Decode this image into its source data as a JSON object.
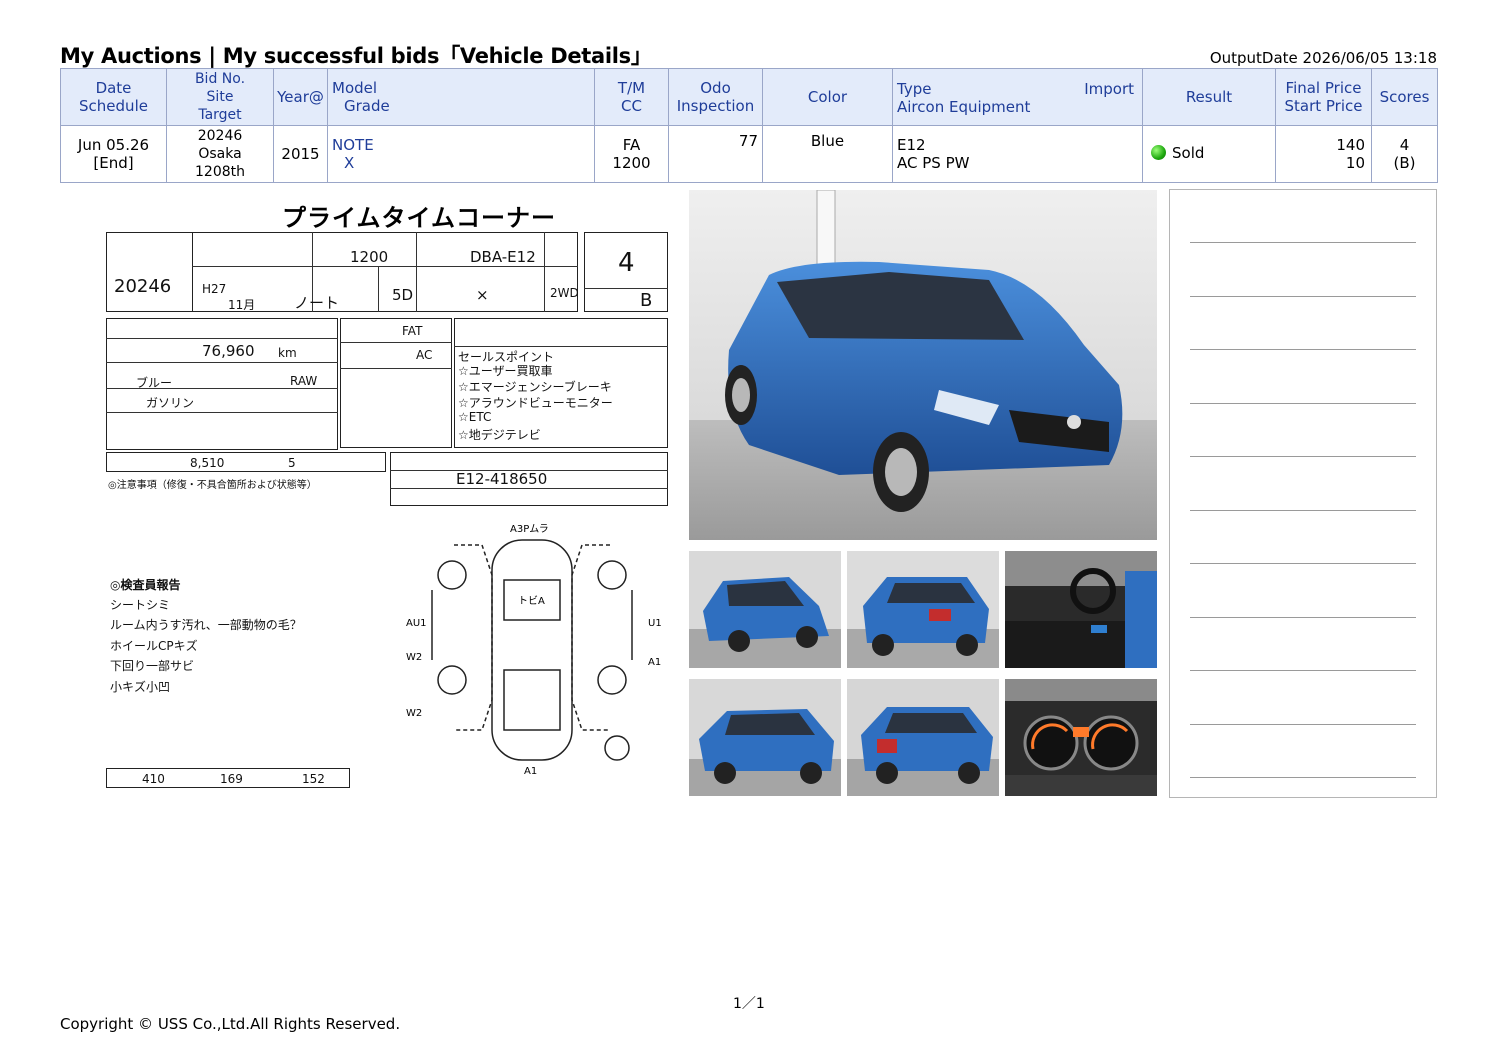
{
  "header": {
    "title": "My Auctions | My successful bids「Vehicle Details」",
    "output_date": "OutputDate  2026/06/05 13:18"
  },
  "table": {
    "headers": {
      "date": [
        "Date",
        "Schedule"
      ],
      "bid": [
        "Bid No.",
        "Site",
        "Target"
      ],
      "year": "Year@",
      "model": [
        "Model",
        "Grade"
      ],
      "tm": [
        "T/M",
        "CC"
      ],
      "odo": [
        "Odo",
        "Inspection"
      ],
      "color": "Color",
      "type": [
        "Type",
        "Aircon Equipment"
      ],
      "import": "Import",
      "result": "Result",
      "price": [
        "Final Price",
        "Start Price"
      ],
      "scores": "Scores"
    },
    "row": {
      "date": "Jun 05.26",
      "schedule": "[End]",
      "bid_no": "20246",
      "site": "Osaka",
      "target": "1208th",
      "year": "2015",
      "model": "NOTE",
      "grade": "X",
      "tm": "FA",
      "cc": "1200",
      "odo": "77",
      "color": "Blue",
      "type": "E12",
      "equipment": "AC PS PW",
      "result": "Sold",
      "final_price": "140",
      "start_price": "10",
      "score": "4",
      "score_sub": "(B)"
    }
  },
  "sheet": {
    "title": "プライムタイムコーナー",
    "lot_no": "20246",
    "reg_year": "H27",
    "reg_month": "11",
    "reg_month_unit": "月",
    "model_name": "ノート",
    "displacement": "1200",
    "model_code": "DBA-E12",
    "doors": "5D",
    "grade": "×",
    "drive": "2WD",
    "score": "4",
    "interior": "B",
    "shift": "FAT",
    "aircon": "AC",
    "mileage": "76,960",
    "mileage_unit": "km",
    "color": "ブルー",
    "color_code": "RAW",
    "fuel": "ガソリン",
    "recycle_fee": "8,510",
    "capacity": "5",
    "chassis": "E12-418650",
    "points_label": "セールスポイント",
    "points": [
      "☆ユーザー買取車",
      "☆エマージェンシーブレーキ",
      "☆アラウンドビューモニター",
      "☆ETC",
      "☆地デジテレビ"
    ],
    "report_label": "◎検査員報告",
    "report": [
      "シートシミ",
      "ルーム内うす汚れ、一部動物の毛？",
      "ホイールCPキズ",
      "下回り一部サビ",
      "小キズ小凹"
    ],
    "notes_label": "◎注意事項（修復・不具合箇所および状態等）",
    "dims": {
      "length": "410",
      "width": "169",
      "height": "152"
    },
    "diagram_labels": {
      "top": "A3Pムラ",
      "door": "トビA",
      "left1": "AU1",
      "left2": "W2",
      "left3": "W2",
      "right1": "U1",
      "right2": "A1",
      "bottom": "A1"
    }
  },
  "photos": [
    "main-front-3q",
    "thumb-front-left",
    "thumb-rear-left",
    "thumb-interior",
    "thumb-front-left-2",
    "thumb-rear-right",
    "thumb-gauges"
  ],
  "footer": {
    "page": "1／1",
    "copyright": "Copyright © USS Co.,Ltd.All Rights Reserved."
  },
  "colors": {
    "header_bg": "#e3ebfa",
    "header_text": "#1f3d99",
    "border": "#9aa6c8",
    "car_blue": "#2f6fc0"
  }
}
